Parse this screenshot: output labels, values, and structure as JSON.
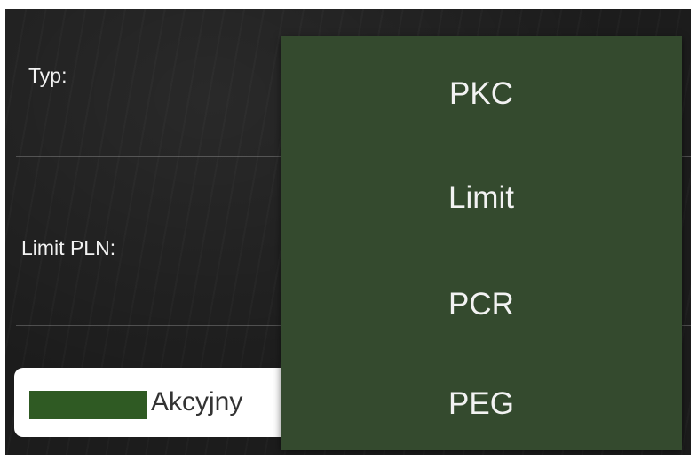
{
  "form": {
    "type_label": "Typ:",
    "limit_label": "Limit PLN:",
    "select": {
      "value": "Akcyjny",
      "swatch_color": "#2f5a23"
    }
  },
  "dropdown": {
    "background_color": "#344a2e",
    "options": [
      {
        "label": "PKC"
      },
      {
        "label": "Limit"
      },
      {
        "label": "PCR"
      },
      {
        "label": "PEG"
      }
    ]
  }
}
